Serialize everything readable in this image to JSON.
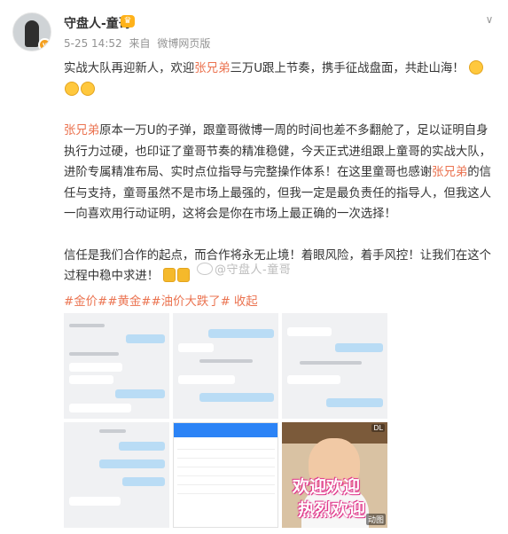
{
  "user": {
    "name": "守盘人-童哥",
    "timestamp": "5-25 14:52",
    "source_prefix": "来自",
    "source": "微博网页版"
  },
  "post": {
    "p1": {
      "a": "实战大队再迎新人，欢迎",
      "name": "张兄弟",
      "b": "三万U跟上节奏，携手征战盘面，共赴山海！"
    },
    "p2": {
      "name1": "张兄弟",
      "a": "原本一万U的子弹，跟童哥微博一周的时间也差不多翻舱了，足以证明自身执行力过硬，也印证了童哥节奏的精准稳健，今天正式进组跟上童哥的实战大队，进阶专属精准布局、实时点位指导与完整操作体系！在这里童哥也感谢",
      "name2": "张兄弟",
      "b": "的信任与支持，童哥虽然不是市场上最强的，但我一定是最负责任的指导人，但我这人一向喜欢用行动证明，这将会是你在市场上最正确的一次选择！"
    },
    "p3": "信任是我们合作的起点，而合作将永无止境！着眼风险，着手风控！让我们在这个过程中稳中求进！",
    "topics": "#金价##黄金##油价大跌了#",
    "collapse": "收起",
    "watermark": "@守盘人-童哥"
  },
  "images": {
    "kid_caption_1": "欢迎欢迎",
    "kid_caption_2": "热烈欢迎",
    "kid_tag": "动图",
    "kid_dl": "DL"
  },
  "icons": [
    "avatar",
    "vip-icon",
    "chevron-down-icon",
    "clap-emoji",
    "cheers-emoji",
    "weibo-logo-icon"
  ],
  "colors": {
    "highlight": "#eb7350",
    "meta": "#939393",
    "text": "#333333"
  }
}
